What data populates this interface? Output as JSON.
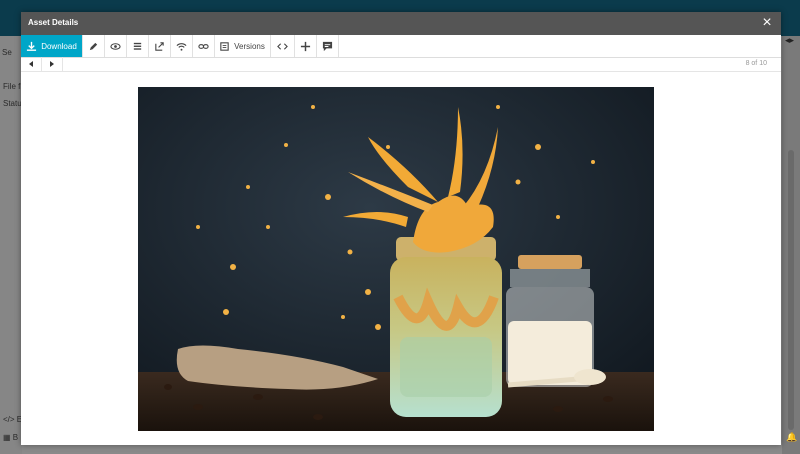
{
  "modal": {
    "title": "Asset Details",
    "close_glyph": "×",
    "counter": "8 of 10"
  },
  "toolbar": {
    "download_label": "Download",
    "versions_label": "Versions",
    "accent": "#00a6c8"
  },
  "background": {
    "file_label": "File fil",
    "status_label": "Status",
    "search_label": "Se",
    "bottom_code_label": "E",
    "bottom_grid_label": "B"
  },
  "image": {
    "description_icon": "milk-coffee-splash-photo"
  }
}
